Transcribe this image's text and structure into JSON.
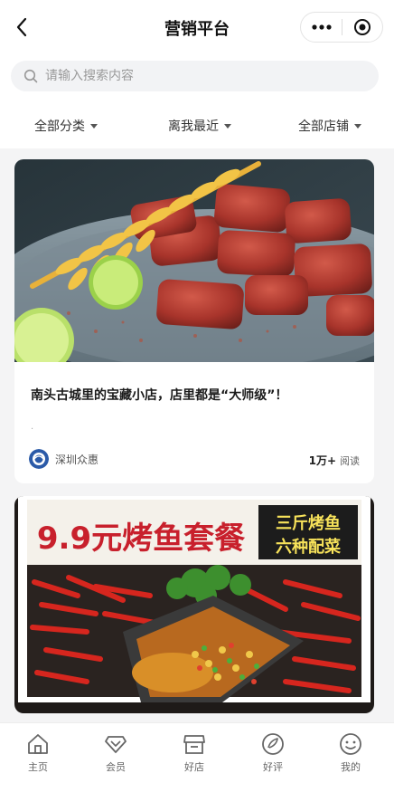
{
  "header": {
    "title": "营销平台",
    "back_icon": "chevron-left-icon",
    "more_icon": "more-dots-icon",
    "close_icon": "target-circle-icon"
  },
  "search": {
    "placeholder": "请输入搜索内容",
    "value": "",
    "icon": "search-icon"
  },
  "filters": [
    {
      "label": "全部分类"
    },
    {
      "label": "离我最近"
    },
    {
      "label": "全部店铺"
    }
  ],
  "cards": [
    {
      "title": "南头古城里的宝藏小店，店里都是“大师级”！",
      "dot": ".",
      "author": "深圳众惠",
      "reads_count": "1万+",
      "reads_label": "阅读"
    },
    {
      "banner_title": "9.9元烤鱼套餐",
      "banner_line1": "三斤烤鱼",
      "banner_line2": "六种配菜"
    }
  ],
  "tabbar": [
    {
      "label": "主页",
      "icon": "home-icon"
    },
    {
      "label": "会员",
      "icon": "diamond-icon"
    },
    {
      "label": "好店",
      "icon": "store-icon"
    },
    {
      "label": "好评",
      "icon": "review-icon"
    },
    {
      "label": "我的",
      "icon": "smile-icon"
    }
  ],
  "colors": {
    "background": "#f4f4f5",
    "banner_red": "#c8202c",
    "banner_yellow": "#f7e25a"
  }
}
